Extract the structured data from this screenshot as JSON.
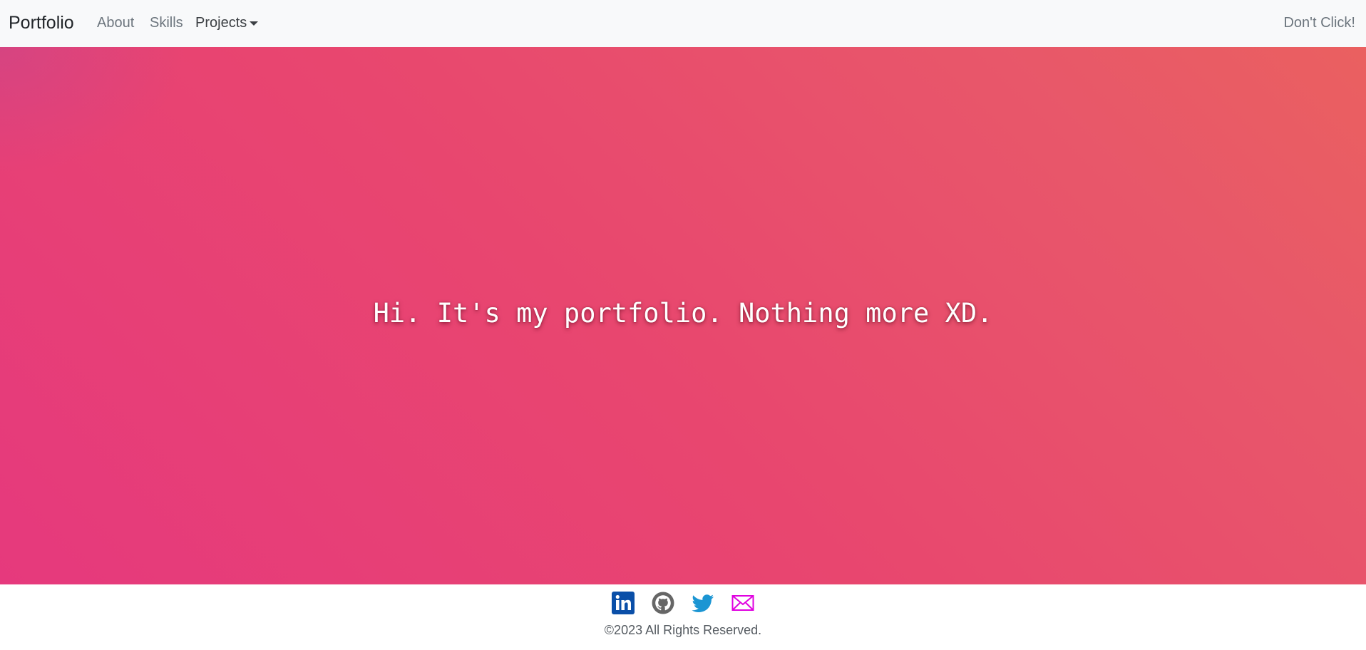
{
  "navbar": {
    "brand": "Portfolio",
    "items": [
      {
        "label": "About"
      },
      {
        "label": "Skills"
      },
      {
        "label": "Projects"
      }
    ],
    "right_link": "Don't Click!"
  },
  "hero": {
    "headline": "Hi. It's my portfolio. Nothing more XD."
  },
  "footer": {
    "social_icons": [
      {
        "name": "linkedin-icon",
        "color": "#0a66c2"
      },
      {
        "name": "github-icon",
        "color": "#666666"
      },
      {
        "name": "twitter-icon",
        "color": "#1da1f2"
      },
      {
        "name": "mail-icon",
        "color": "#e000e0"
      }
    ],
    "copyright": "©2023 All Rights Reserved."
  },
  "colors": {
    "navbar_bg": "#f8f9fa",
    "hero_gradient_start": "#e6397d",
    "hero_gradient_end": "#ea6060",
    "headline_text": "#ffffff"
  }
}
